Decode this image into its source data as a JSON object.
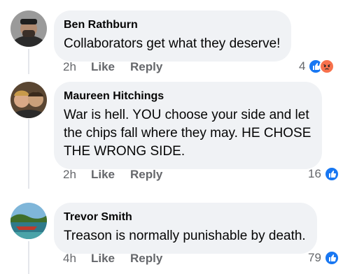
{
  "comments": [
    {
      "author": "Ben Rathburn",
      "lines": [
        "Collaborators get what they deserve!"
      ],
      "time": "2h",
      "like_label": "Like",
      "reply_label": "Reply",
      "reaction_count": "4",
      "reactions": [
        "like-icon",
        "angry-icon"
      ]
    },
    {
      "author": "Maureen Hitchings",
      "lines": [
        "War is hell. YOU choose your side and let",
        "the chips fall where they may. HE CHOSE",
        "THE WRONG SIDE."
      ],
      "time": "2h",
      "like_label": "Like",
      "reply_label": "Reply",
      "reaction_count": "16",
      "reactions": [
        "like-icon"
      ]
    },
    {
      "author": "Trevor Smith",
      "lines": [
        "Treason is normally punishable by death."
      ],
      "time": "4h",
      "like_label": "Like",
      "reply_label": "Reply",
      "reaction_count": "79",
      "reactions": [
        "like-icon"
      ]
    }
  ],
  "colors": {
    "like_blue": "#1877f2",
    "angry_orange": "#f7714c",
    "bubble_bg": "#f0f2f5",
    "meta_gray": "#65676b"
  }
}
